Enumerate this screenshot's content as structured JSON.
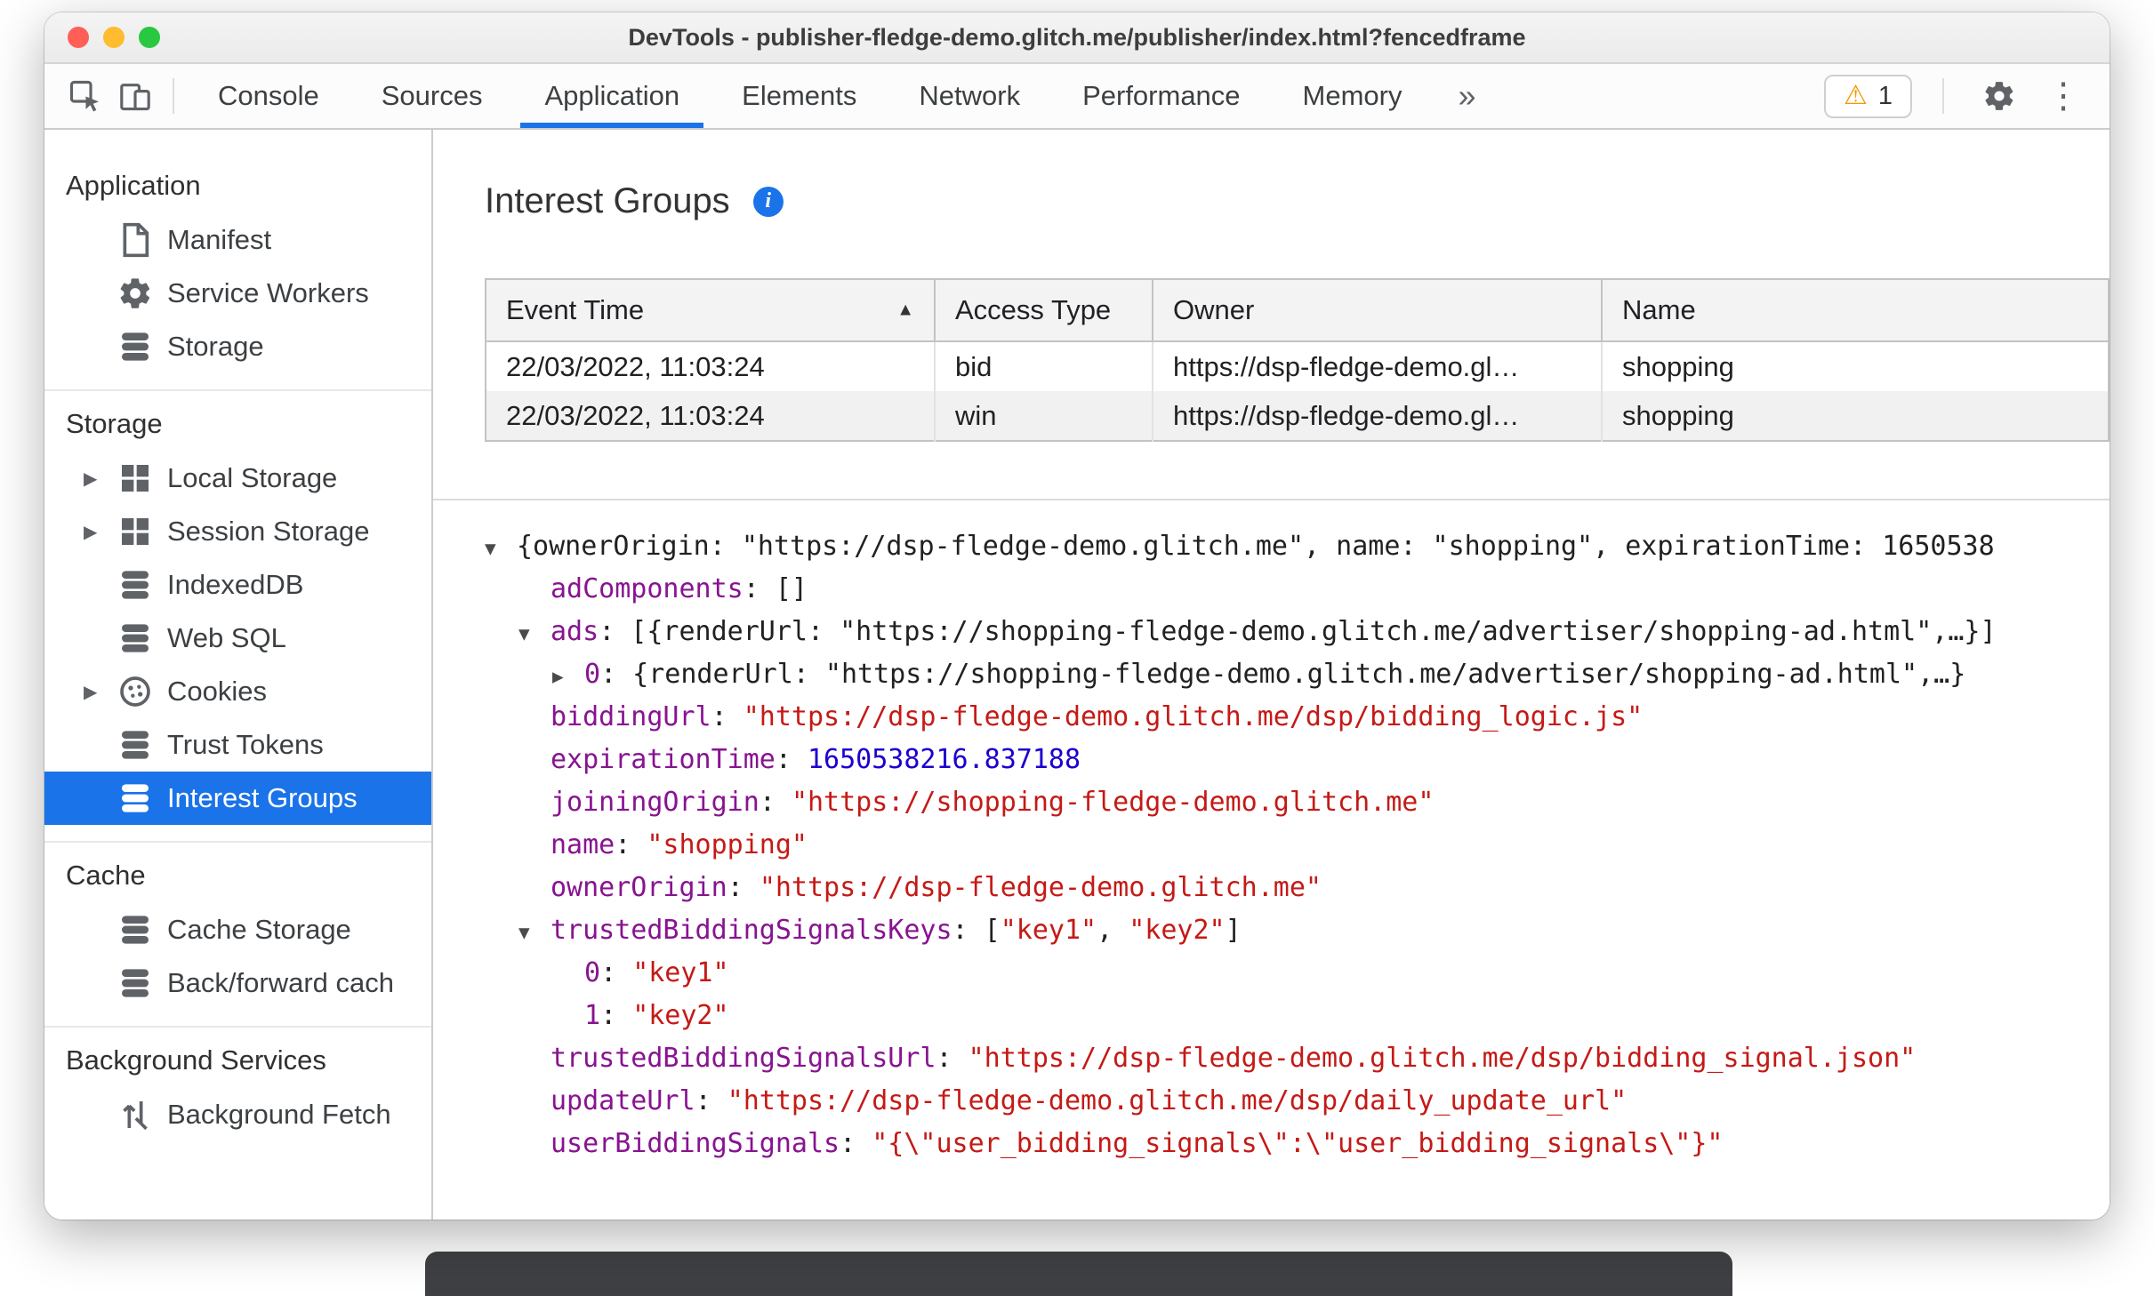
{
  "colors": {
    "accent": "#1a73e8",
    "key": "#881391",
    "string": "#c41a16",
    "number": "#1c00cf",
    "warning": "#f29900"
  },
  "glyphs": {
    "warning": "⚠",
    "more_tabs": "»",
    "dots": "⋮",
    "sort_asc": "▲",
    "chevron_right": "▶",
    "triangle_down": "▼",
    "triangle_right": "▶",
    "info": "i"
  },
  "window": {
    "title": "DevTools - publisher-fledge-demo.glitch.me/publisher/index.html?fencedframe"
  },
  "toolbar": {
    "left_icons": [
      "inspect-icon",
      "device-toolbar-icon"
    ],
    "tabs": [
      {
        "label": "Console",
        "active": false
      },
      {
        "label": "Sources",
        "active": false
      },
      {
        "label": "Application",
        "active": true
      },
      {
        "label": "Elements",
        "active": false
      },
      {
        "label": "Network",
        "active": false
      },
      {
        "label": "Performance",
        "active": false
      },
      {
        "label": "Memory",
        "active": false
      }
    ],
    "more_tabs_label": "»",
    "warning": {
      "icon": "warning-icon",
      "count": "1"
    },
    "right_icons": [
      "gear-icon",
      "three-dot-menu-icon"
    ]
  },
  "sidebar": {
    "sections": [
      {
        "header": "Application",
        "items": [
          {
            "icon": "manifest-icon",
            "label": "Manifest",
            "expandable": false,
            "selected": false
          },
          {
            "icon": "gear-icon",
            "label": "Service Workers",
            "expandable": false,
            "selected": false
          },
          {
            "icon": "database-icon",
            "label": "Storage",
            "expandable": false,
            "selected": false
          }
        ]
      },
      {
        "header": "Storage",
        "items": [
          {
            "icon": "table-icon",
            "label": "Local Storage",
            "expandable": true,
            "selected": false
          },
          {
            "icon": "table-icon",
            "label": "Session Storage",
            "expandable": true,
            "selected": false
          },
          {
            "icon": "database-icon",
            "label": "IndexedDB",
            "expandable": false,
            "selected": false
          },
          {
            "icon": "database-icon",
            "label": "Web SQL",
            "expandable": false,
            "selected": false
          },
          {
            "icon": "cookie-icon",
            "label": "Cookies",
            "expandable": true,
            "selected": false
          },
          {
            "icon": "database-icon",
            "label": "Trust Tokens",
            "expandable": false,
            "selected": false
          },
          {
            "icon": "database-icon",
            "label": "Interest Groups",
            "expandable": false,
            "selected": true
          }
        ]
      },
      {
        "header": "Cache",
        "items": [
          {
            "icon": "database-icon",
            "label": "Cache Storage",
            "expandable": false,
            "selected": false
          },
          {
            "icon": "database-icon",
            "label": "Back/forward cach",
            "expandable": false,
            "selected": false
          }
        ]
      },
      {
        "header": "Background Services",
        "items": [
          {
            "icon": "fetch-icon",
            "label": "Background Fetch",
            "expandable": false,
            "selected": false
          }
        ]
      }
    ]
  },
  "main": {
    "title": "Interest Groups",
    "table": {
      "columns": [
        "Event Time",
        "Access Type",
        "Owner",
        "Name"
      ],
      "sorted_column": "Event Time",
      "rows": [
        [
          "22/03/2022, 11:03:24",
          "bid",
          "https://dsp-fledge-demo.gl…",
          "shopping"
        ],
        [
          "22/03/2022, 11:03:24",
          "win",
          "https://dsp-fledge-demo.gl…",
          "shopping"
        ]
      ]
    },
    "tree": [
      {
        "indent": 0,
        "arrow": "down",
        "tokens": [
          {
            "t": "plain",
            "v": "{ownerOrigin: \"https://dsp-fledge-demo.glitch.me\", name: \"shopping\", expirationTime: 1650538"
          }
        ]
      },
      {
        "indent": 1,
        "arrow": null,
        "tokens": [
          {
            "t": "key",
            "v": "adComponents"
          },
          {
            "t": "plain",
            "v": ": []"
          }
        ]
      },
      {
        "indent": 1,
        "arrow": "down",
        "tokens": [
          {
            "t": "key",
            "v": "ads"
          },
          {
            "t": "plain",
            "v": ": [{renderUrl: \"https://shopping-fledge-demo.glitch.me/advertiser/shopping-ad.html\",…}]"
          }
        ]
      },
      {
        "indent": 2,
        "arrow": "right",
        "tokens": [
          {
            "t": "key",
            "v": "0"
          },
          {
            "t": "plain",
            "v": ": {renderUrl: \"https://shopping-fledge-demo.glitch.me/advertiser/shopping-ad.html\",…}"
          }
        ]
      },
      {
        "indent": 1,
        "arrow": null,
        "tokens": [
          {
            "t": "key",
            "v": "biddingUrl"
          },
          {
            "t": "plain",
            "v": ": "
          },
          {
            "t": "str",
            "v": "\"https://dsp-fledge-demo.glitch.me/dsp/bidding_logic.js\""
          }
        ]
      },
      {
        "indent": 1,
        "arrow": null,
        "tokens": [
          {
            "t": "key",
            "v": "expirationTime"
          },
          {
            "t": "plain",
            "v": ": "
          },
          {
            "t": "num",
            "v": "1650538216.837188"
          }
        ]
      },
      {
        "indent": 1,
        "arrow": null,
        "tokens": [
          {
            "t": "key",
            "v": "joiningOrigin"
          },
          {
            "t": "plain",
            "v": ": "
          },
          {
            "t": "str",
            "v": "\"https://shopping-fledge-demo.glitch.me\""
          }
        ]
      },
      {
        "indent": 1,
        "arrow": null,
        "tokens": [
          {
            "t": "key",
            "v": "name"
          },
          {
            "t": "plain",
            "v": ": "
          },
          {
            "t": "str",
            "v": "\"shopping\""
          }
        ]
      },
      {
        "indent": 1,
        "arrow": null,
        "tokens": [
          {
            "t": "key",
            "v": "ownerOrigin"
          },
          {
            "t": "plain",
            "v": ": "
          },
          {
            "t": "str",
            "v": "\"https://dsp-fledge-demo.glitch.me\""
          }
        ]
      },
      {
        "indent": 1,
        "arrow": "down",
        "tokens": [
          {
            "t": "key",
            "v": "trustedBiddingSignalsKeys"
          },
          {
            "t": "plain",
            "v": ": ["
          },
          {
            "t": "str",
            "v": "\"key1\""
          },
          {
            "t": "plain",
            "v": ", "
          },
          {
            "t": "str",
            "v": "\"key2\""
          },
          {
            "t": "plain",
            "v": "]"
          }
        ]
      },
      {
        "indent": 2,
        "arrow": null,
        "tokens": [
          {
            "t": "key",
            "v": "0"
          },
          {
            "t": "plain",
            "v": ": "
          },
          {
            "t": "str",
            "v": "\"key1\""
          }
        ]
      },
      {
        "indent": 2,
        "arrow": null,
        "tokens": [
          {
            "t": "key",
            "v": "1"
          },
          {
            "t": "plain",
            "v": ": "
          },
          {
            "t": "str",
            "v": "\"key2\""
          }
        ]
      },
      {
        "indent": 1,
        "arrow": null,
        "tokens": [
          {
            "t": "key",
            "v": "trustedBiddingSignalsUrl"
          },
          {
            "t": "plain",
            "v": ": "
          },
          {
            "t": "str",
            "v": "\"https://dsp-fledge-demo.glitch.me/dsp/bidding_signal.json\""
          }
        ]
      },
      {
        "indent": 1,
        "arrow": null,
        "tokens": [
          {
            "t": "key",
            "v": "updateUrl"
          },
          {
            "t": "plain",
            "v": ": "
          },
          {
            "t": "str",
            "v": "\"https://dsp-fledge-demo.glitch.me/dsp/daily_update_url\""
          }
        ]
      },
      {
        "indent": 1,
        "arrow": null,
        "tokens": [
          {
            "t": "key",
            "v": "userBiddingSignals"
          },
          {
            "t": "plain",
            "v": ": "
          },
          {
            "t": "str",
            "v": "\"{\\\"user_bidding_signals\\\":\\\"user_bidding_signals\\\"}\""
          }
        ]
      }
    ]
  }
}
